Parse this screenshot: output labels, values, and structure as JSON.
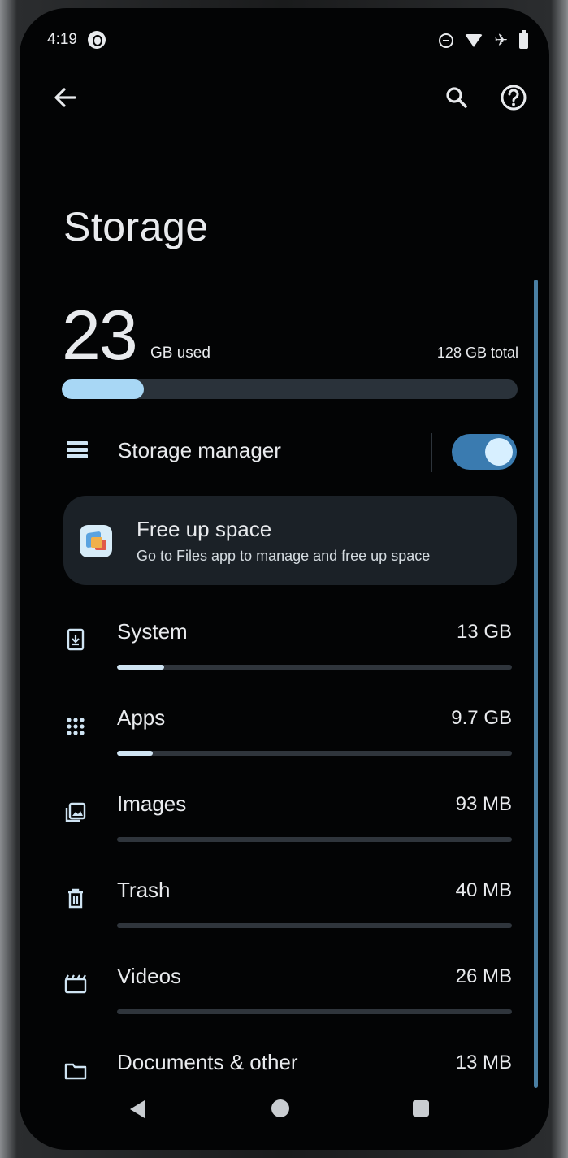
{
  "status_bar": {
    "time": "4:19",
    "icons": [
      "media-badge-icon",
      "do-not-disturb-icon",
      "wifi-icon",
      "airplane-icon",
      "battery-icon"
    ]
  },
  "header": {
    "back_icon": "arrow-left-icon",
    "search_icon": "search-icon",
    "help_icon": "help-circle-icon"
  },
  "page_title": "Storage",
  "summary": {
    "used_number": "23",
    "used_unit": "GB used",
    "total": "128 GB total",
    "used_fraction": 0.18
  },
  "storage_manager": {
    "label": "Storage manager",
    "icon": "storage-manager-icon",
    "enabled": true
  },
  "free_up": {
    "title": "Free up space",
    "subtitle": "Go to Files app to manage and free up space",
    "icon": "files-app-icon"
  },
  "categories": [
    {
      "label": "System",
      "value": "13 GB",
      "icon": "system-download-icon",
      "fraction": 0.12
    },
    {
      "label": "Apps",
      "value": "9.7 GB",
      "icon": "apps-grid-icon",
      "fraction": 0.09
    },
    {
      "label": "Images",
      "value": "93 MB",
      "icon": "images-icon",
      "fraction": 0.0
    },
    {
      "label": "Trash",
      "value": "40 MB",
      "icon": "trash-icon",
      "fraction": 0.0
    },
    {
      "label": "Videos",
      "value": "26 MB",
      "icon": "videos-icon",
      "fraction": 0.0
    },
    {
      "label": "Documents & other",
      "value": "13 MB",
      "icon": "folder-icon",
      "fraction": 0.0
    }
  ],
  "colors": {
    "background": "#030405",
    "text": "#e8eaed",
    "accent": "#3a7bb0",
    "bar_fill": "#a8d7f5",
    "card": "#1b2127"
  },
  "nav_bar": {
    "icons": [
      "nav-back-icon",
      "nav-home-icon",
      "nav-recents-icon"
    ]
  }
}
